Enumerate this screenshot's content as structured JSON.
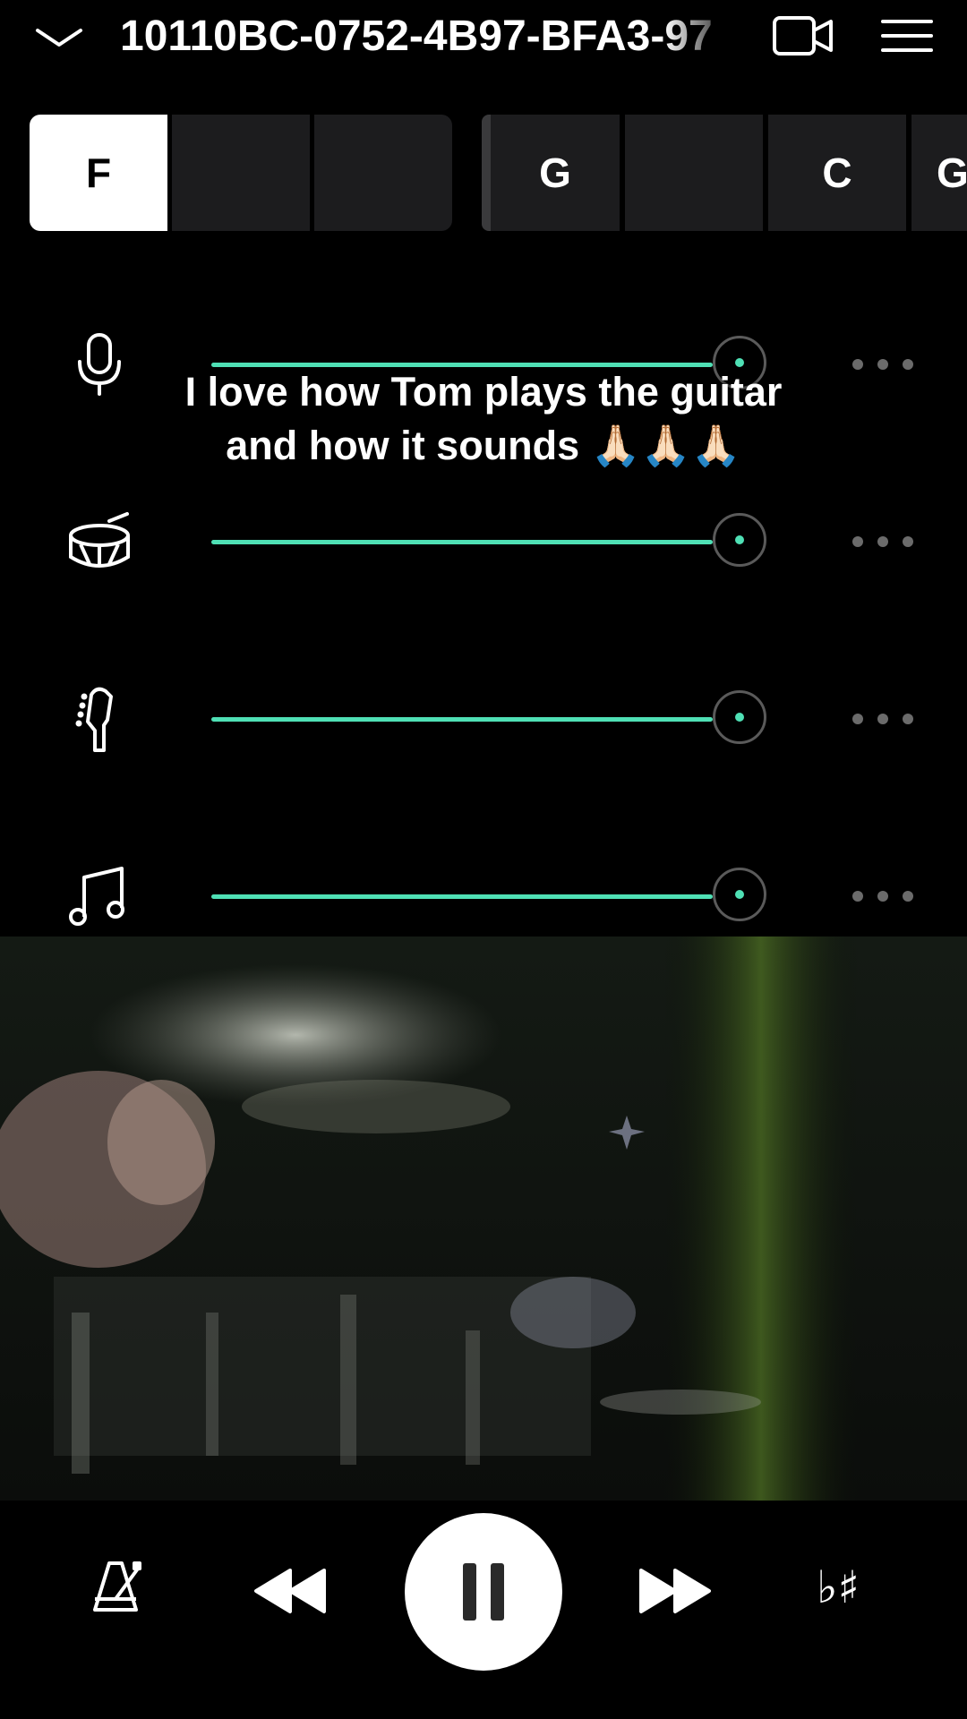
{
  "header": {
    "title": "10110BC-0752-4B97-BFA3-97",
    "icons": [
      "chevron-down-icon",
      "video-camera-icon",
      "menu-icon"
    ]
  },
  "chords": [
    {
      "label": "F",
      "active": true
    },
    {
      "label": ""
    },
    {
      "label": ""
    },
    {
      "label": "G"
    },
    {
      "label": ""
    },
    {
      "label": "C"
    },
    {
      "label": "G"
    }
  ],
  "tracks": [
    {
      "icon": "microphone-icon",
      "level": 1.0
    },
    {
      "icon": "drum-icon",
      "level": 1.0
    },
    {
      "icon": "guitar-headstock-icon",
      "level": 1.0
    },
    {
      "icon": "music-note-icon",
      "level": 1.0
    }
  ],
  "comment": {
    "text": "I love how Tom plays the guitar and how it sounds 🙏🏻🙏🏻🙏🏻"
  },
  "controls": {
    "icons": [
      "metronome-icon",
      "rewind-icon",
      "pause-icon",
      "fast-forward-icon",
      "transpose-icon"
    ],
    "transpose_label": "♭♯"
  },
  "colors": {
    "accent": "#4fe0b5",
    "background": "#000000",
    "cell": "#1c1c1e"
  }
}
